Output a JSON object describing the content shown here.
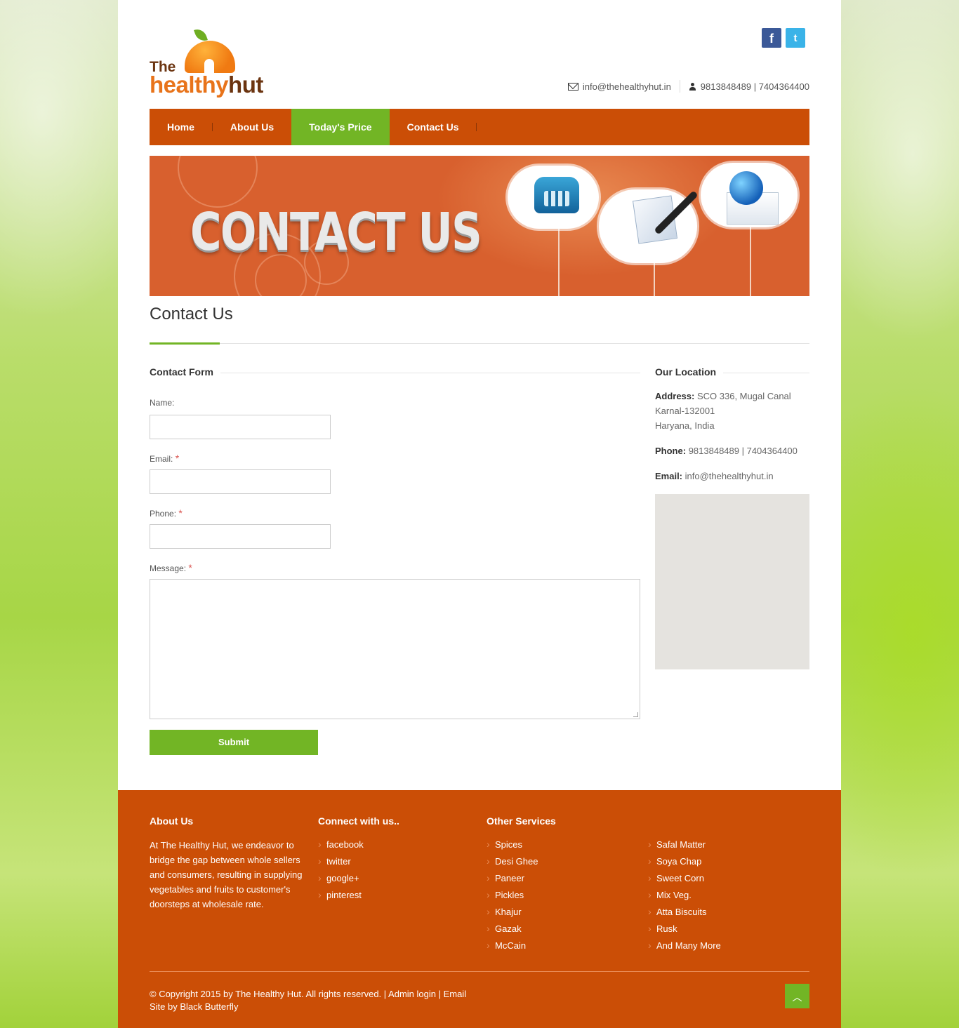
{
  "header": {
    "logo": {
      "the": "The",
      "healthy": "healthy",
      "hut": "hut"
    },
    "social": {
      "facebook_icon": "f",
      "twitter_icon": "t"
    },
    "email": "info@thehealthyhut.in",
    "phones": "9813848489 | 7404364400"
  },
  "nav": {
    "items": [
      "Home",
      "About Us",
      "Today's Price",
      "Contact Us"
    ],
    "active_index": 2
  },
  "banner": {
    "title": "CONTACT US"
  },
  "main": {
    "title": "Contact Us",
    "form": {
      "heading": "Contact Form",
      "name_label": "Name:",
      "email_label": "Email:",
      "phone_label": "Phone:",
      "message_label": "Message:",
      "required_mark": "*",
      "submit_label": "Submit"
    },
    "location": {
      "heading": "Our Location",
      "address_label": "Address:",
      "address_line1": "SCO 336, Mugal Canal",
      "address_line2": "Karnal-132001",
      "address_line3": "Haryana, India",
      "phone_label": "Phone:",
      "phone_value": "9813848489 | 7404364400",
      "email_label": "Email:",
      "email_value": "info@thehealthyhut.in"
    }
  },
  "footer": {
    "about": {
      "heading": "About Us",
      "text": "At The Healthy Hut, we endeavor to bridge the gap between whole sellers and consumers, resulting in supplying vegetables and fruits to customer's doorsteps at wholesale rate."
    },
    "connect": {
      "heading": "Connect with us..",
      "links": [
        "facebook",
        "twitter",
        "google+",
        "pinterest"
      ]
    },
    "services": {
      "heading": "Other Services",
      "col1": [
        "Spices",
        "Desi Ghee",
        "Paneer",
        "Pickles",
        "Khajur",
        "Gazak",
        "McCain"
      ],
      "col2": [
        "Safal Matter",
        "Soya Chap",
        "Sweet Corn",
        "Mix Veg.",
        "Atta Biscuits",
        "Rusk",
        "And Many More"
      ]
    },
    "copyright": "© Copyright 2015 by The Healthy Hut. All rights reserved. | Admin login | Email",
    "credit": "Site by Black Butterfly"
  },
  "colors": {
    "brand_orange": "#cb4e06",
    "brand_green": "#72b525"
  }
}
